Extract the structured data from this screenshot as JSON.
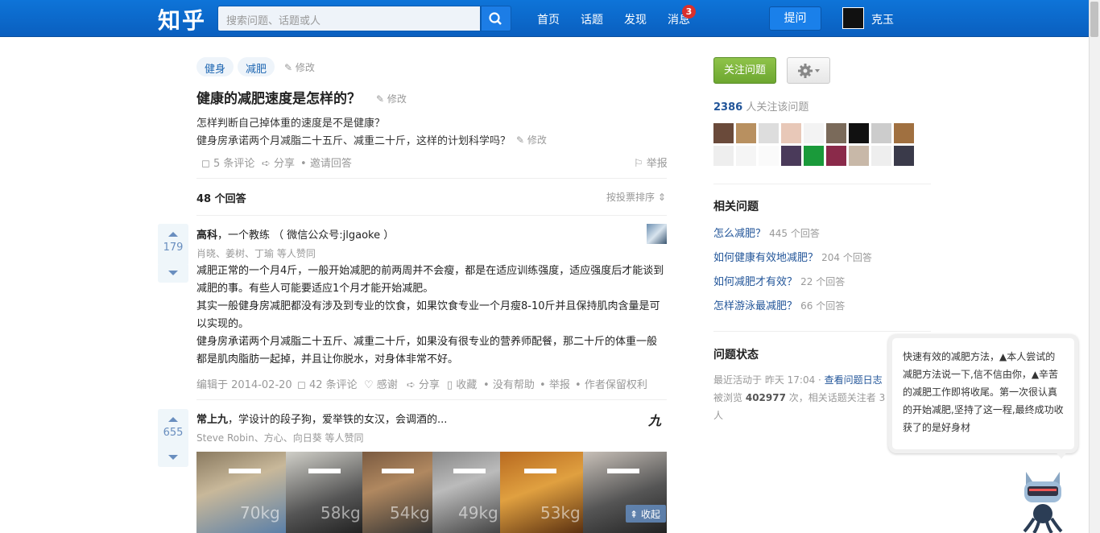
{
  "header": {
    "logo": "知乎",
    "search_placeholder": "搜索问题、话题或人",
    "nav": [
      "首页",
      "话题",
      "发现",
      "消息"
    ],
    "message_count": "3",
    "ask_label": "提问",
    "user_name": "克玉"
  },
  "question": {
    "tags": [
      "健身",
      "减肥"
    ],
    "edit": "修改",
    "title": "健康的减肥速度是怎样的？",
    "detail_line1": "怎样判断自己掉体重的速度是不是健康？",
    "detail_line2": "健身房承诺两个月减脂二十五斤、减重二十斤，这样的计划科学吗？",
    "comments": "5 条评论",
    "share": "分享",
    "invite": "邀请回答",
    "report": "举报",
    "answer_count": "48 个回答",
    "sort": "按投票排序"
  },
  "answers": [
    {
      "votes": "179",
      "author": "高科",
      "bio": "，一个教练 （ 微信公众号:jlgaoke ）",
      "voters": "肖晓、姜树、丁瑜 等人赞同",
      "paragraphs": [
        "减肥正常的一个月4斤，一般开始减肥的前两周并不会瘦，都是在适应训练强度，适应强度后才能谈到减肥的事。有些人可能要适应1个月才能开始减肥。",
        "其实一般健身房减肥都没有涉及到专业的饮食，如果饮食专业一个月瘦8-10斤并且保持肌肉含量是可以实现的。",
        "健身房承诺两个月减脂二十五斤、减重二十斤，如果没有很专业的营养师配餐，那二十斤的体重一般都是肌肉脂肪一起掉，并且让你脱水，对身体非常不好。"
      ],
      "edited": "编辑于 2014-02-20",
      "comments": "42 条评论",
      "thanks": "感谢",
      "share": "分享",
      "collect": "收藏",
      "nohelp": "没有帮助",
      "report": "举报",
      "rights": "作者保留权利"
    },
    {
      "votes": "655",
      "author": "常上九",
      "bio": "，学设计的段子狗，爱举铁的女汉，会调酒的...",
      "voters": "Steve Robin、方心、向日葵 等人赞同",
      "weights": [
        "70kg",
        "58kg",
        "54kg",
        "49kg",
        "53kg"
      ],
      "collapse": "收起",
      "logo_char": "九"
    }
  ],
  "sidebar": {
    "follow_label": "关注问题",
    "followers_count": "2386",
    "followers_text": "人关注该问题",
    "related_title": "相关问题",
    "related": [
      {
        "q": "怎么减肥？",
        "n": "445 个回答"
      },
      {
        "q": "如何健康有效地减肥？",
        "n": "204 个回答"
      },
      {
        "q": "如何减肥才有效？",
        "n": "22 个回答"
      },
      {
        "q": "怎样游泳最减肥？",
        "n": "66 个回答"
      }
    ],
    "status_title": "问题状态",
    "status_line1": "最近活动于 昨天 17:04 ·",
    "status_log_link": "查看问题日志",
    "status_views_pre": "被浏览",
    "status_views": "402977",
    "status_views_post": "次，相关话题关注者 3",
    "status_people": "人"
  },
  "tooltip": {
    "text": "快速有效的减肥方法，▲本人尝试的减肥方法说一下,信不信由你，▲辛苦的减肥工作即将收尾。第一次很认真的开始减肥,坚持了这一程,最终成功收获了的是好身材"
  },
  "colors": {
    "topbar": "#0a63c8",
    "link": "#225599",
    "follow": "#7cb83d",
    "badge": "#d9302c"
  }
}
